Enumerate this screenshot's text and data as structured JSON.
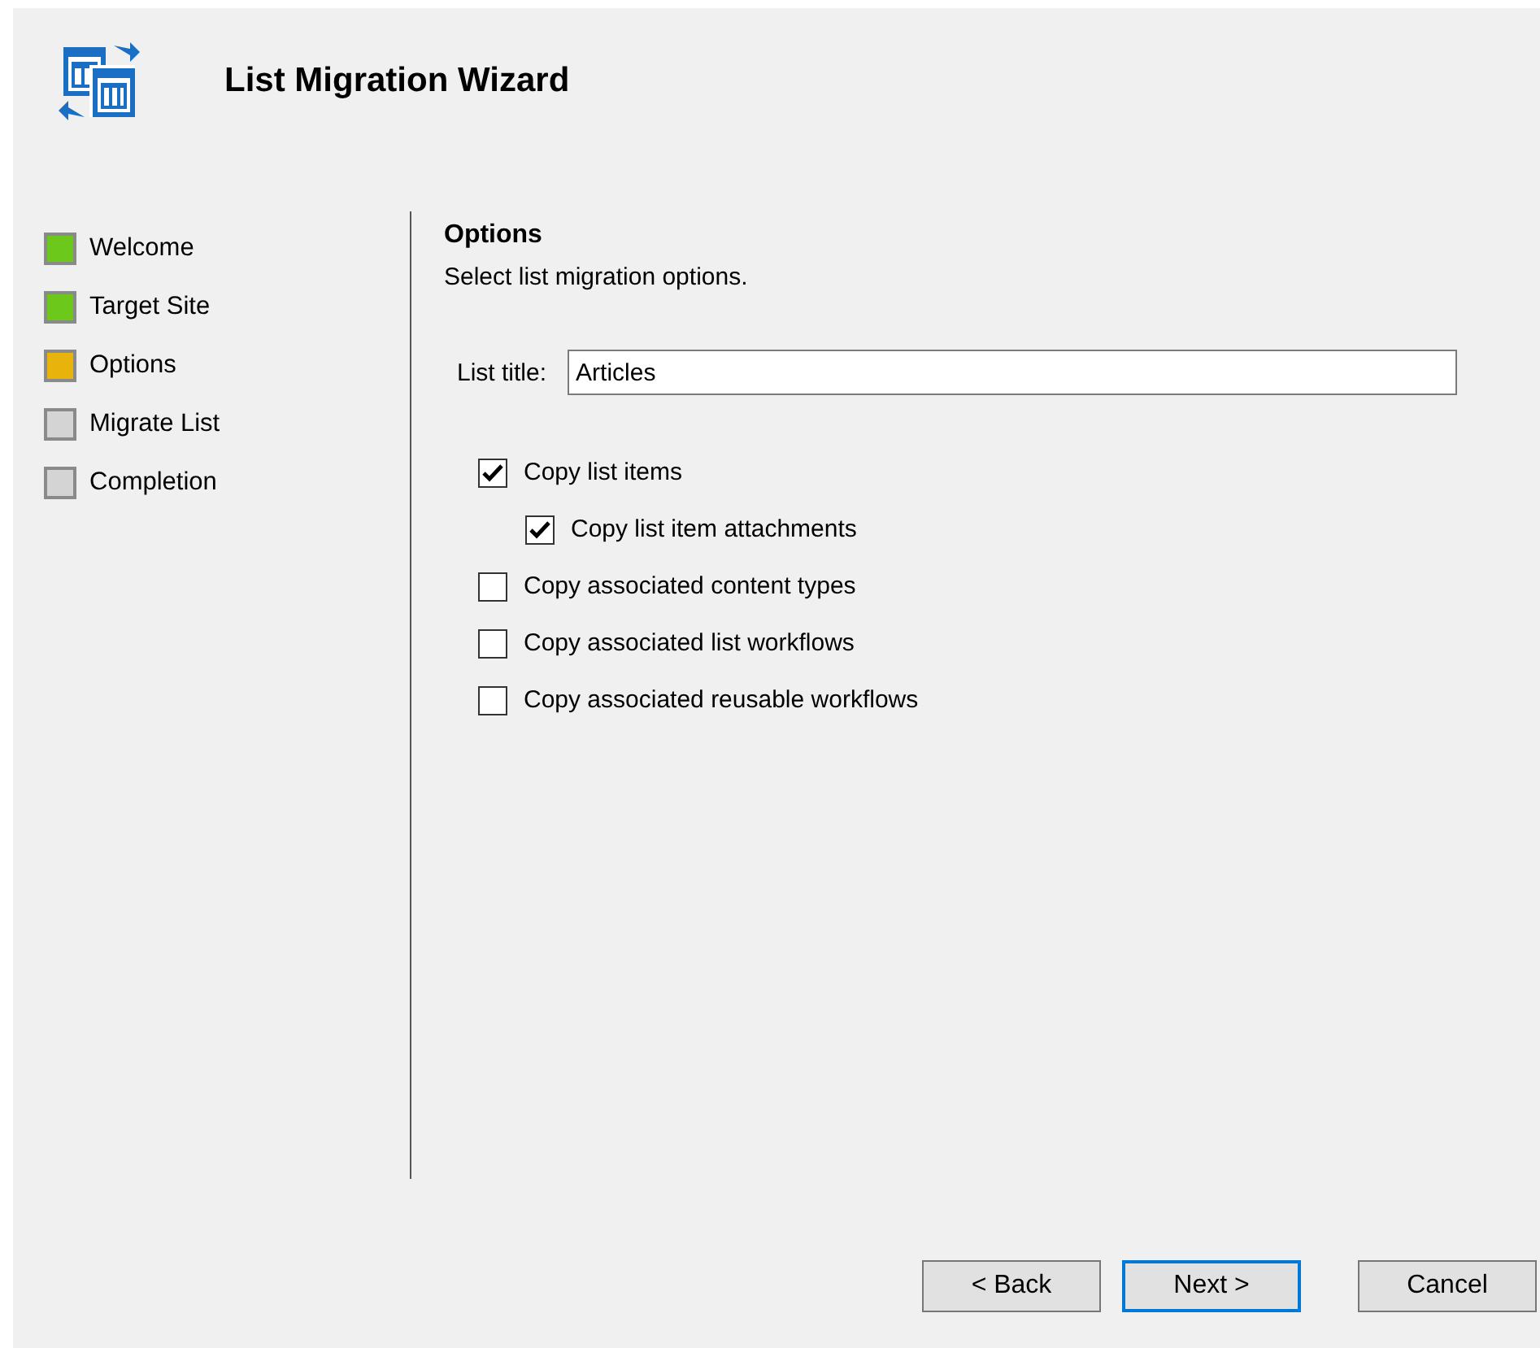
{
  "window": {
    "title": "List Migration Wizard"
  },
  "steps": [
    {
      "label": "Welcome",
      "color": "#6cc81a"
    },
    {
      "label": "Target Site",
      "color": "#6cc81a"
    },
    {
      "label": "Options",
      "color": "#e8b40c"
    },
    {
      "label": "Migrate List",
      "color": "#d4d4d4"
    },
    {
      "label": "Completion",
      "color": "#d4d4d4"
    }
  ],
  "page": {
    "heading": "Options",
    "description": "Select list migration options."
  },
  "list_title": {
    "label": "List title:",
    "value": "Articles"
  },
  "options": [
    {
      "label": "Copy list items",
      "checked": true,
      "children": [
        {
          "label": "Copy list item attachments",
          "checked": true
        }
      ]
    },
    {
      "label": "Copy associated content types",
      "checked": false
    },
    {
      "label": "Copy associated list workflows",
      "checked": false
    },
    {
      "label": "Copy associated reusable workflows",
      "checked": false
    }
  ],
  "buttons": [
    {
      "label": "< Back",
      "focused": false
    },
    {
      "label": "Next >",
      "focused": true
    },
    {
      "label": "Cancel",
      "focused": false
    }
  ]
}
